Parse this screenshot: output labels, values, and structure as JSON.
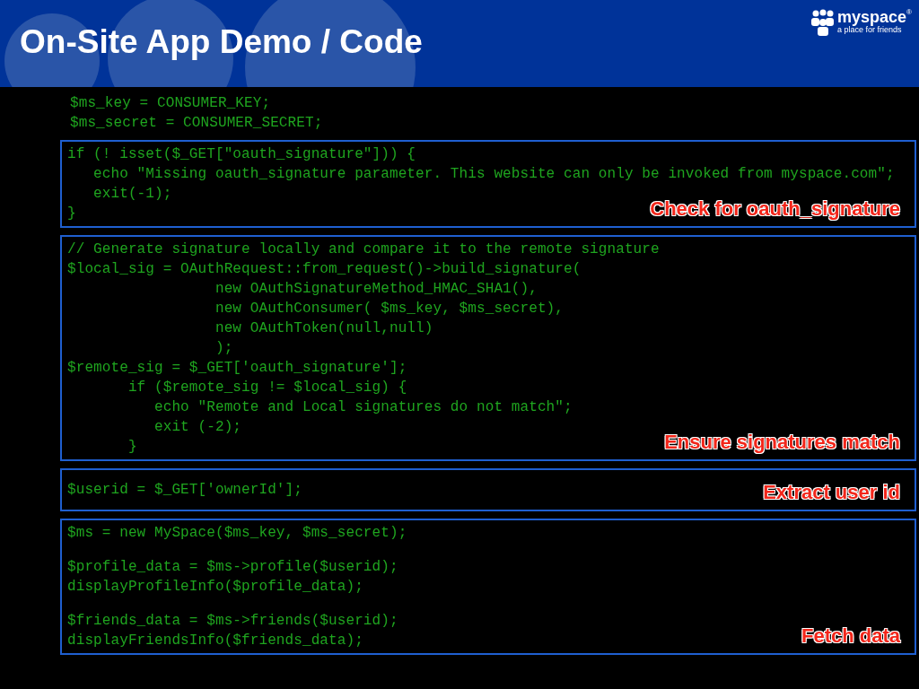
{
  "title": "On-Site App Demo / Code",
  "logo": {
    "name": "myspace",
    "mark": "®",
    "tagline": "a place for friends"
  },
  "code": {
    "intro_lines": [
      "$ms_key = CONSUMER_KEY;",
      "$ms_secret = CONSUMER_SECRET;"
    ],
    "blocks": [
      {
        "label": "Check for oauth_signature",
        "groups": [
          [
            "if (! isset($_GET[\"oauth_signature\"])) {",
            "   echo \"Missing oauth_signature parameter. This website can only be invoked from myspace.com\";",
            "   exit(-1);",
            "}"
          ]
        ]
      },
      {
        "label": "Ensure signatures match",
        "groups": [
          [
            "// Generate signature locally and compare it to the remote signature",
            "$local_sig = OAuthRequest::from_request()->build_signature(",
            "                 new OAuthSignatureMethod_HMAC_SHA1(),",
            "                 new OAuthConsumer( $ms_key, $ms_secret),",
            "                 new OAuthToken(null,null)",
            "                 );",
            "$remote_sig = $_GET['oauth_signature'];",
            "       if ($remote_sig != $local_sig) {",
            "          echo \"Remote and Local signatures do not match\";",
            "          exit (-2);",
            "       }"
          ]
        ]
      },
      {
        "label": "Extract user id",
        "groups": [
          [
            "$userid = $_GET['ownerId'];"
          ]
        ]
      },
      {
        "label": "Fetch data",
        "groups": [
          [
            "$ms = new MySpace($ms_key, $ms_secret);"
          ],
          [
            "$profile_data = $ms->profile($userid);",
            "displayProfileInfo($profile_data);"
          ],
          [
            "$friends_data = $ms->friends($userid);",
            "displayFriendsInfo($friends_data);"
          ]
        ]
      }
    ]
  }
}
